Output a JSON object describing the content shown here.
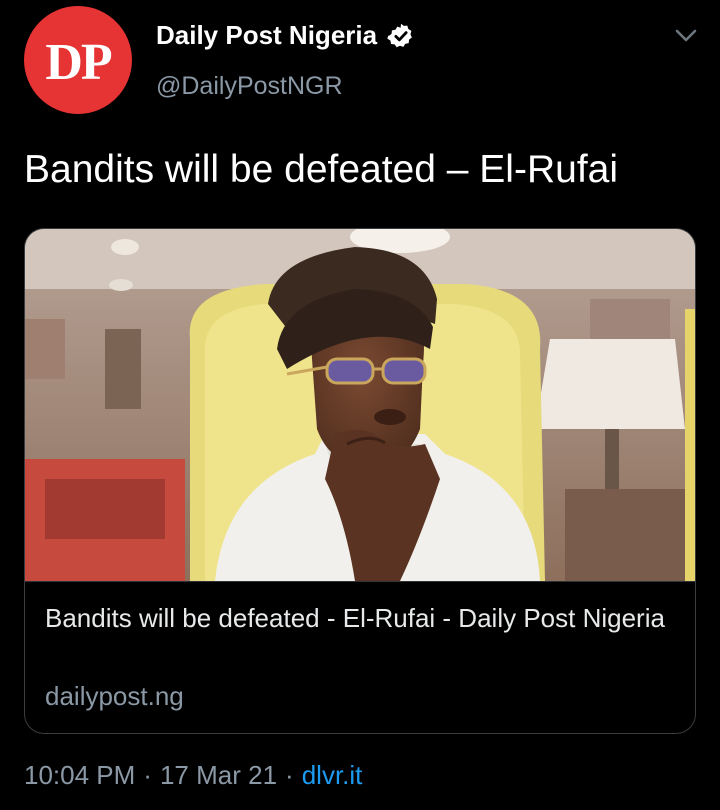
{
  "account": {
    "avatar_text": "DP",
    "display_name": "Daily Post Nigeria",
    "handle": "@DailyPostNGR",
    "verified_icon": "verified-badge-icon"
  },
  "menu_icon": "chevron-down-icon",
  "tweet": {
    "text": "Bandits will be defeated – El-Rufai"
  },
  "link_card": {
    "image": "photo of man in white clothing and dark cap sitting in yellow chair, hand on chin",
    "title": "Bandits will be defeated - El-Rufai - Daily Post Nigeria",
    "domain": "dailypost.ng"
  },
  "meta": {
    "time": "10:04 PM",
    "date": "17 Mar 21",
    "separator": "·",
    "source": "dlvr.it"
  },
  "colors": {
    "background": "#000000",
    "avatar_red": "#e63333",
    "secondary_text": "#8b98a5",
    "link_blue": "#1d9bf0"
  }
}
